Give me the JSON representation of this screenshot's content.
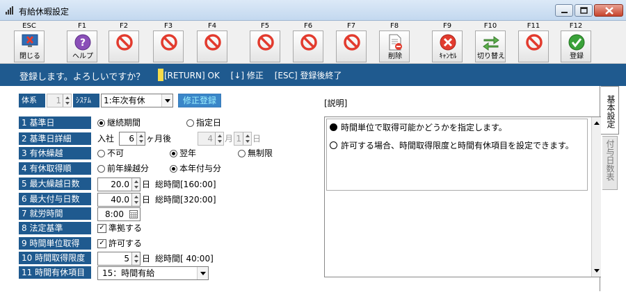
{
  "window": {
    "title": "有給休暇設定"
  },
  "toolbar": [
    {
      "key": "ESC",
      "caption": "閉じる",
      "icon": "monitor-close-icon"
    },
    {
      "key": "F1",
      "caption": "ヘルプ",
      "icon": "help-icon"
    },
    {
      "key": "F2",
      "caption": "",
      "icon": "disabled-icon"
    },
    {
      "key": "F3",
      "caption": "",
      "icon": "disabled-icon"
    },
    {
      "key": "F4",
      "caption": "",
      "icon": "disabled-icon"
    },
    {
      "key": "F5",
      "caption": "",
      "icon": "disabled-icon"
    },
    {
      "key": "F6",
      "caption": "",
      "icon": "disabled-icon"
    },
    {
      "key": "F7",
      "caption": "",
      "icon": "disabled-icon"
    },
    {
      "key": "F8",
      "caption": "削除",
      "icon": "delete-document-icon"
    },
    {
      "key": "F9",
      "caption": "ｷｬﾝｾﾙ",
      "icon": "cancel-icon"
    },
    {
      "key": "F10",
      "caption": "切り替え",
      "icon": "switch-arrows-icon"
    },
    {
      "key": "F11",
      "caption": "",
      "icon": "disabled-icon"
    },
    {
      "key": "F12",
      "caption": "登録",
      "icon": "check-icon"
    }
  ],
  "prompt": {
    "message": "登録します。よろしいですか？",
    "keys": "[RETURN] OK　 [↓] 修正　 [ESC] 登録後終了"
  },
  "header": {
    "system_label": "体系",
    "system_value": "1",
    "scheme_label": "ｼｽﾃﾑ",
    "scheme_value": "1:年次有休",
    "correct_button": "修正登録"
  },
  "rows": [
    {
      "label": "1 基準日"
    },
    {
      "label": "2 基準日詳細"
    },
    {
      "label": "3 有休繰越"
    },
    {
      "label": "4 有休取得順"
    },
    {
      "label": "5 最大繰越日数"
    },
    {
      "label": "6 最大付与日数"
    },
    {
      "label": "7 就労時間"
    },
    {
      "label": "8 法定基準"
    },
    {
      "label": "9 時間単位取得"
    },
    {
      "label": "10 時間取得限度"
    },
    {
      "label": "11 時間有休項目"
    }
  ],
  "values": {
    "base_continuous": "継続期間",
    "base_specified": "指定日",
    "join_label": "入社",
    "join_months": "6",
    "months_after": "ヶ月後",
    "month_value": "4",
    "month_unit": "月",
    "day_value": "1",
    "day_unit": "日",
    "carry_no": "不可",
    "carry_next": "翌年",
    "carry_unlimited": "無制限",
    "order_prev": "前年繰越分",
    "order_current": "本年付与分",
    "max_carry": "20.0",
    "max_carry_unit": "日",
    "max_carry_total": "総時間[160:00]",
    "max_grant": "40.0",
    "max_grant_unit": "日",
    "max_grant_total": "総時間[320:00]",
    "work_hours": "8:00",
    "legal_standard": "準拠する",
    "hourly_allowed": "許可する",
    "hour_limit": "5",
    "hour_limit_unit": "日",
    "hour_limit_total": "総時間[ 40:00]",
    "hourly_item": "15：時間有給"
  },
  "description": {
    "title": "[説明]",
    "lines": [
      {
        "bullet": "filled",
        "text": "時間単位で取得可能かどうかを指定します。"
      },
      {
        "bullet": "empty",
        "text": "許可する場合、時間取得限度と時間有休項目を設定できます。"
      }
    ]
  },
  "tabs": {
    "basic": "基本設定",
    "grant": "付与日数表"
  },
  "colors": {
    "label_blue": "#1f5a8f",
    "prompt_bar": "#1f5a8f",
    "cursor": "#f7dc4a"
  }
}
